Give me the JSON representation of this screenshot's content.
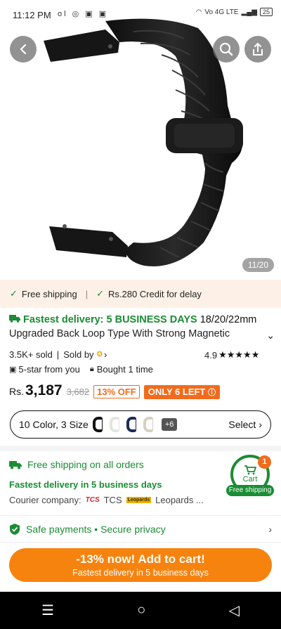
{
  "status_bar": {
    "time": "11:12 PM",
    "left_icons": "ol ◎ ▣ ▣",
    "network": "Vo 4G LTE",
    "battery": "25"
  },
  "gallery": {
    "counter": "11/20",
    "back_icon": "chevron-left-icon",
    "search_icon": "search-icon",
    "share_icon": "share-icon"
  },
  "banner": {
    "free_shipping": "Free shipping",
    "separator": "|",
    "credit": "Rs.280 Credit for delay"
  },
  "product": {
    "fast_label": "Fastest delivery: 5 BUSINESS DAYS",
    "title_start": " 18/20/22mm",
    "title_line2": "Upgraded Back Loop Type With Strong Magnetic",
    "sold": "3.5K+ sold",
    "sold_by": "Sold by",
    "rating": "4.9",
    "stars": "★★★★★",
    "five_star": "5-star from you",
    "bought": "Bought 1 time"
  },
  "price": {
    "currency": "Rs.",
    "current": "3,187",
    "original": "3,682",
    "discount": "13% OFF",
    "stock": "ONLY 6 LEFT"
  },
  "variant": {
    "label": "10 Color, 3 Size",
    "more": "+6",
    "select": "Select"
  },
  "shipping": {
    "title": "Free shipping on all orders",
    "fastest": "Fastest delivery in 5 business days",
    "courier_label": "Courier company:",
    "tcs_logo": "TCS",
    "tcs": "TCS",
    "leopards_logo": "Leopards",
    "leopards": "Leopards ..."
  },
  "cart": {
    "label": "Cart",
    "count": "1",
    "badge": "Free shipping"
  },
  "safety": {
    "text": "Safe payments • Secure privacy"
  },
  "cta": {
    "line1": "-13% now! Add to cart!",
    "line2": "Fastest delivery in 5 business days"
  },
  "colors": {
    "accent": "#f26b1d",
    "cta": "#f7830f",
    "green": "#1a8c33"
  }
}
